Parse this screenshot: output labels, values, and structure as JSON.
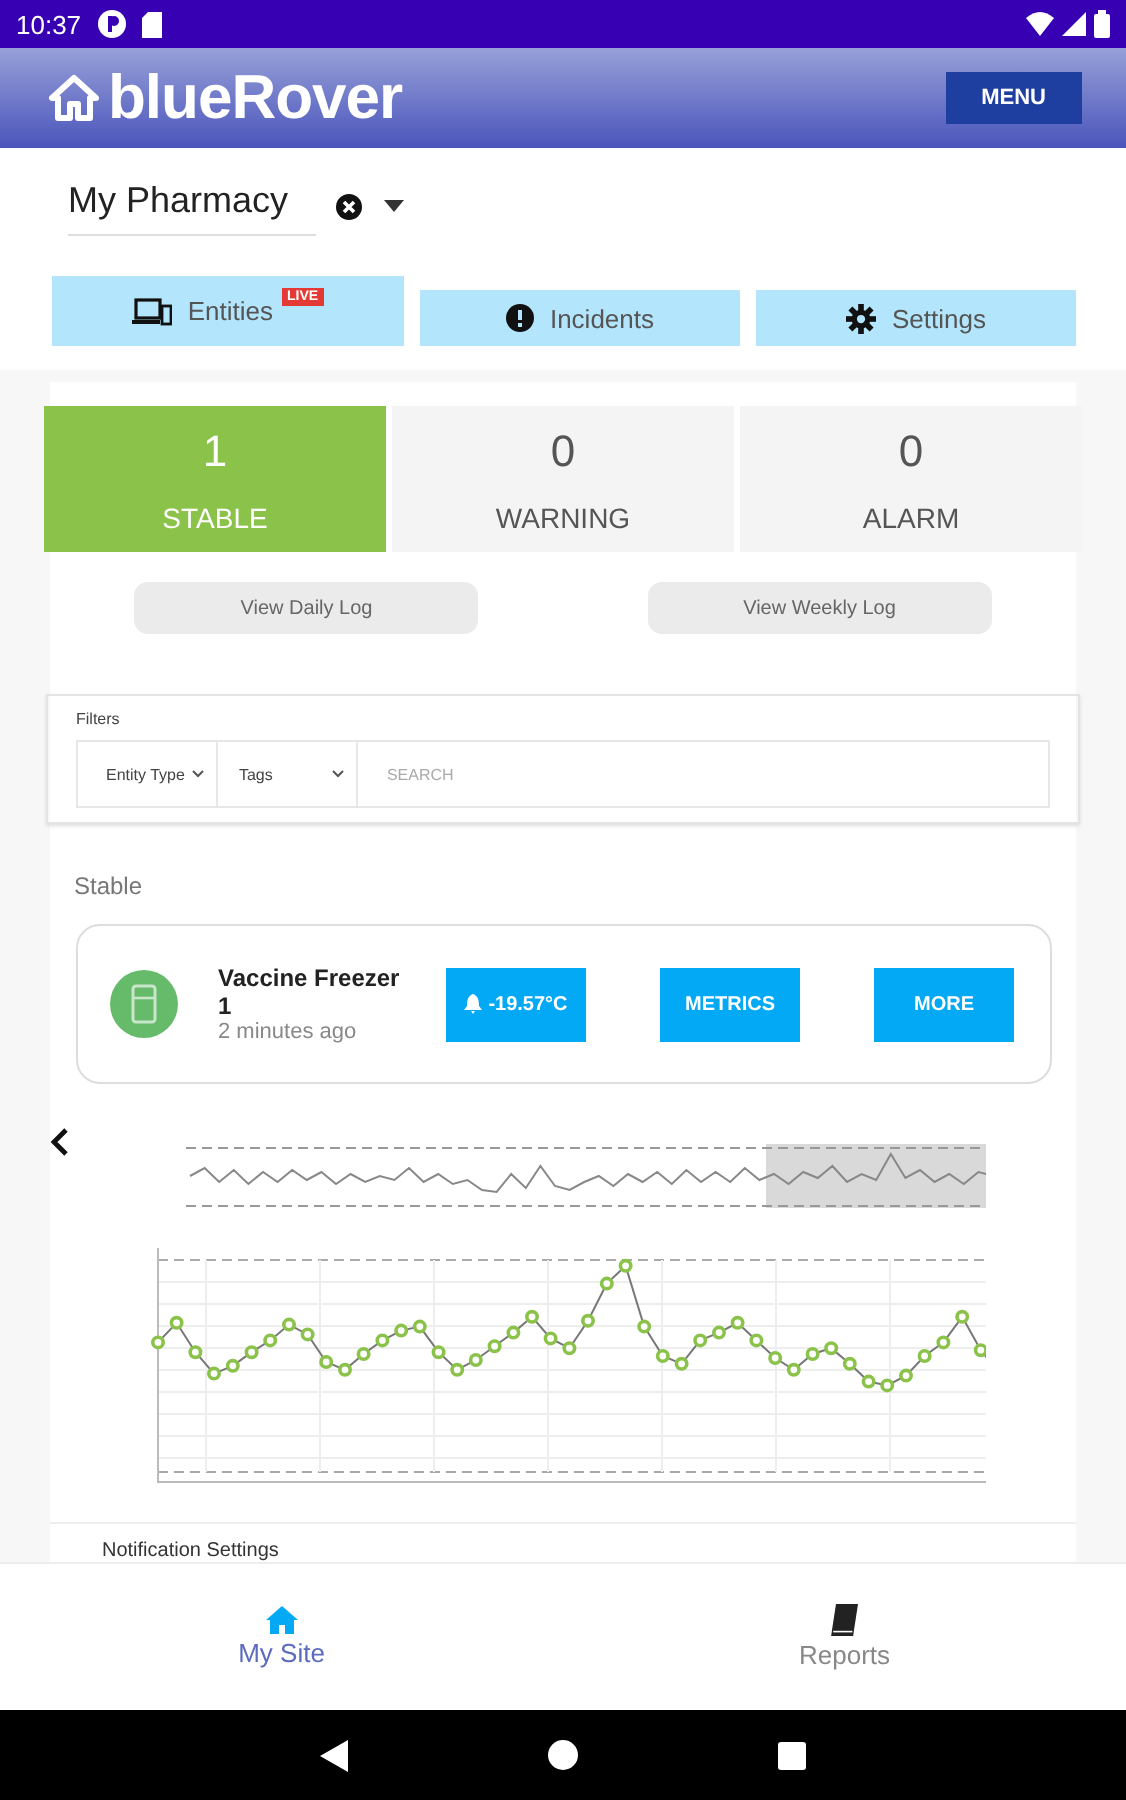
{
  "status_bar": {
    "time": "10:37"
  },
  "header": {
    "brand": "blueRover",
    "menu_button": "MENU"
  },
  "site_selector": {
    "value": "My Pharmacy"
  },
  "tabs": [
    {
      "label": "Entities",
      "badge": "LIVE",
      "selected": true
    },
    {
      "label": "Incidents",
      "selected": false
    },
    {
      "label": "Settings",
      "selected": false
    }
  ],
  "summary": [
    {
      "count": "1",
      "label": "STABLE",
      "selected": true
    },
    {
      "count": "0",
      "label": "WARNING",
      "selected": false
    },
    {
      "count": "0",
      "label": "ALARM",
      "selected": false
    }
  ],
  "log_buttons": [
    "View Daily Log",
    "View Weekly Log"
  ],
  "filters": {
    "title": "Filters",
    "dropdowns": [
      "Entity Type",
      "Tags"
    ],
    "search": {
      "placeholder": "SEARCH"
    }
  },
  "section_title": "Stable",
  "entities": [
    {
      "name": "Vaccine Freezer 1",
      "updated": "2 minutes ago",
      "reading": "-19.57°C",
      "buttons": [
        "METRICS",
        "MORE"
      ]
    }
  ],
  "next_heading": "Notification Settings",
  "bottom_nav": [
    {
      "label": "My Site",
      "selected": true
    },
    {
      "label": "Reports",
      "selected": false
    }
  ]
}
